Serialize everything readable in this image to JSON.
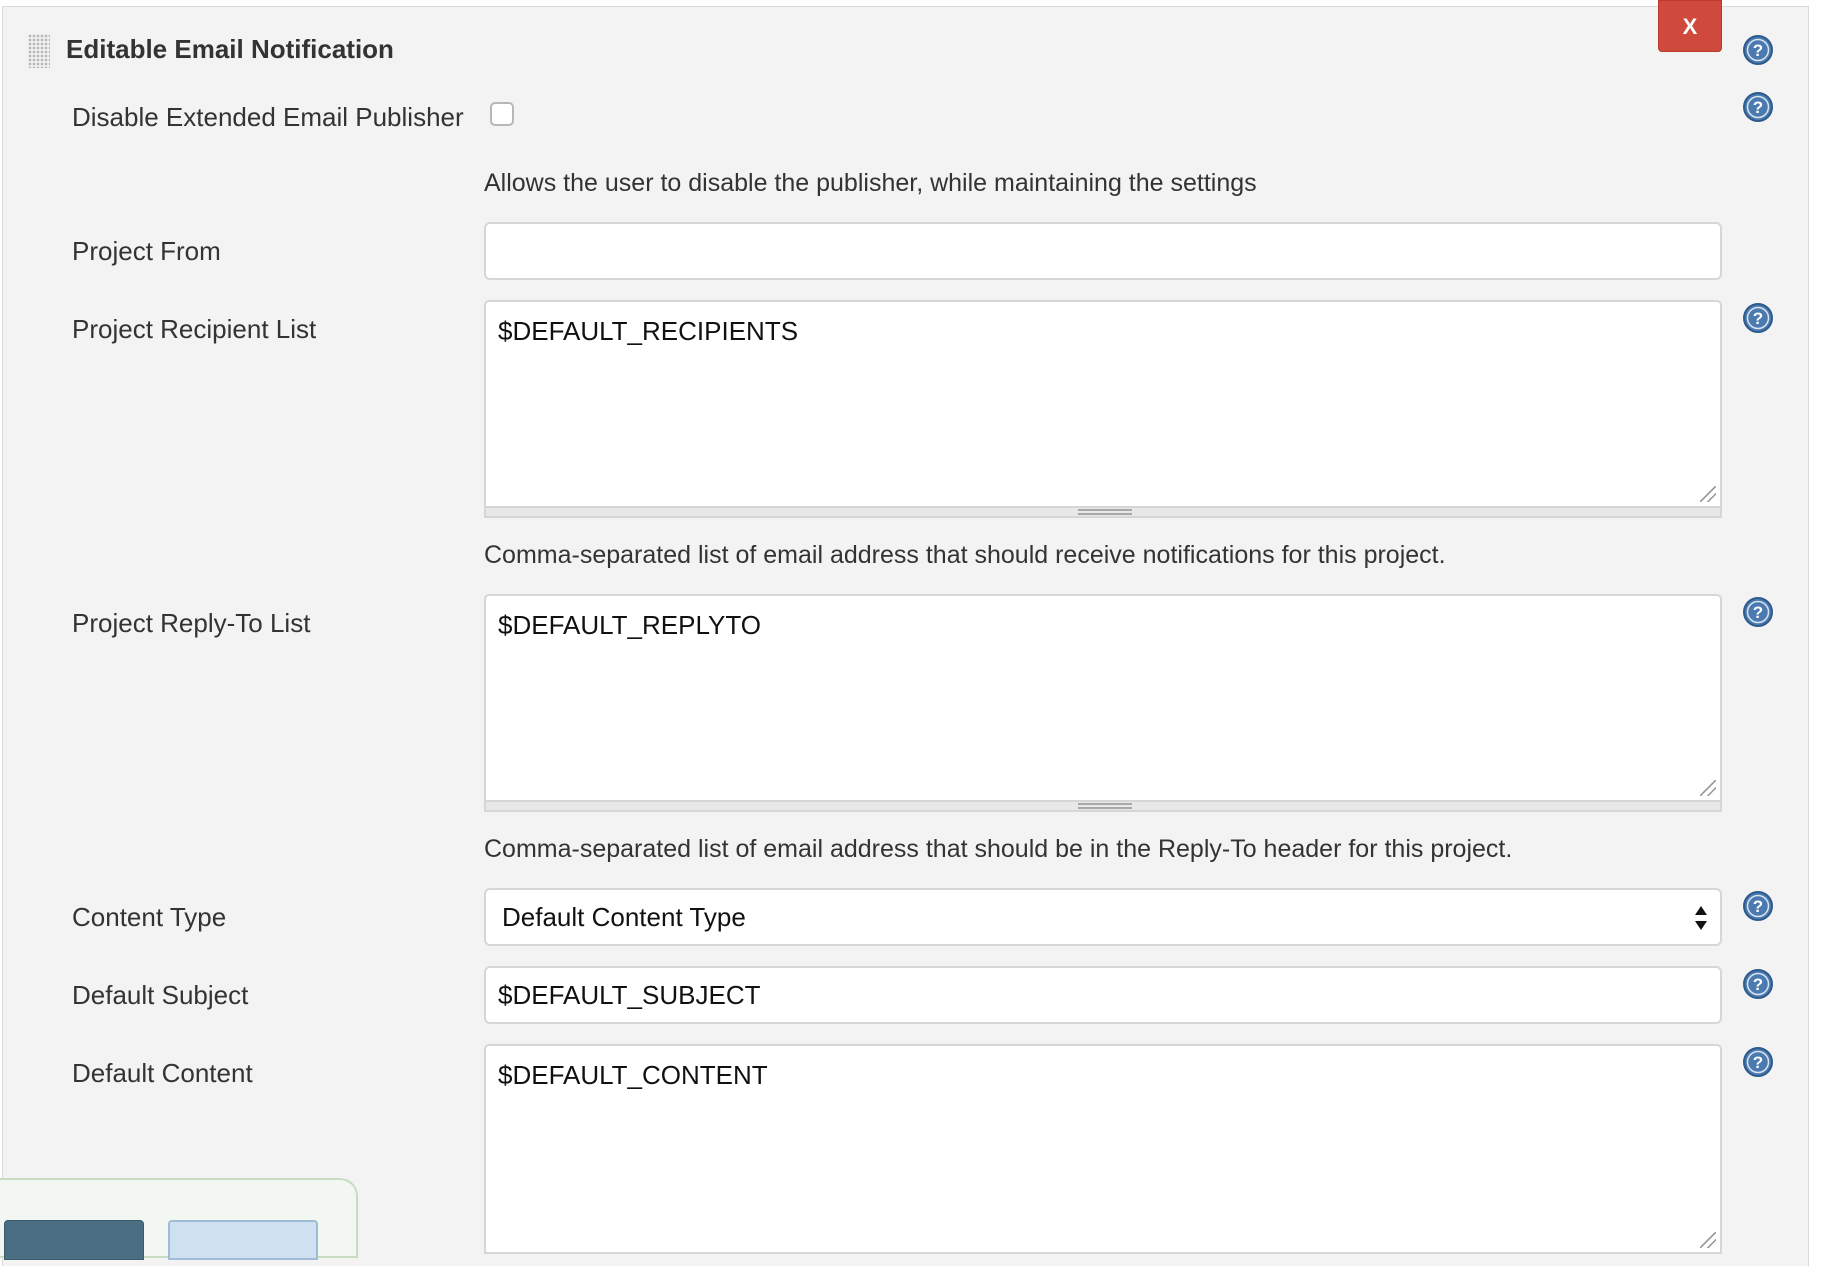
{
  "section": {
    "title": "Editable Email Notification",
    "close_label": "X"
  },
  "disable_publisher": {
    "label": "Disable Extended Email Publisher",
    "checked": false,
    "description": "Allows the user to disable the publisher, while maintaining the settings"
  },
  "project_from": {
    "label": "Project From",
    "value": ""
  },
  "recipient_list": {
    "label": "Project Recipient List",
    "value": "$DEFAULT_RECIPIENTS",
    "description": "Comma-separated list of email address that should receive notifications for this project."
  },
  "reply_to_list": {
    "label": "Project Reply-To List",
    "value": "$DEFAULT_REPLYTO",
    "description": "Comma-separated list of email address that should be in the Reply-To header for this project."
  },
  "content_type": {
    "label": "Content Type",
    "selected": "Default Content Type"
  },
  "default_subject": {
    "label": "Default Subject",
    "value": "$DEFAULT_SUBJECT"
  },
  "default_content": {
    "label": "Default Content",
    "value": "$DEFAULT_CONTENT"
  },
  "colors": {
    "close_button": "#cf4a3c",
    "help_icon": "#4a7ab0",
    "save_button": "#4b6e82",
    "apply_button": "#cfe0f0"
  },
  "icons": {
    "help": "help-icon",
    "drag": "drag-handle-icon"
  }
}
